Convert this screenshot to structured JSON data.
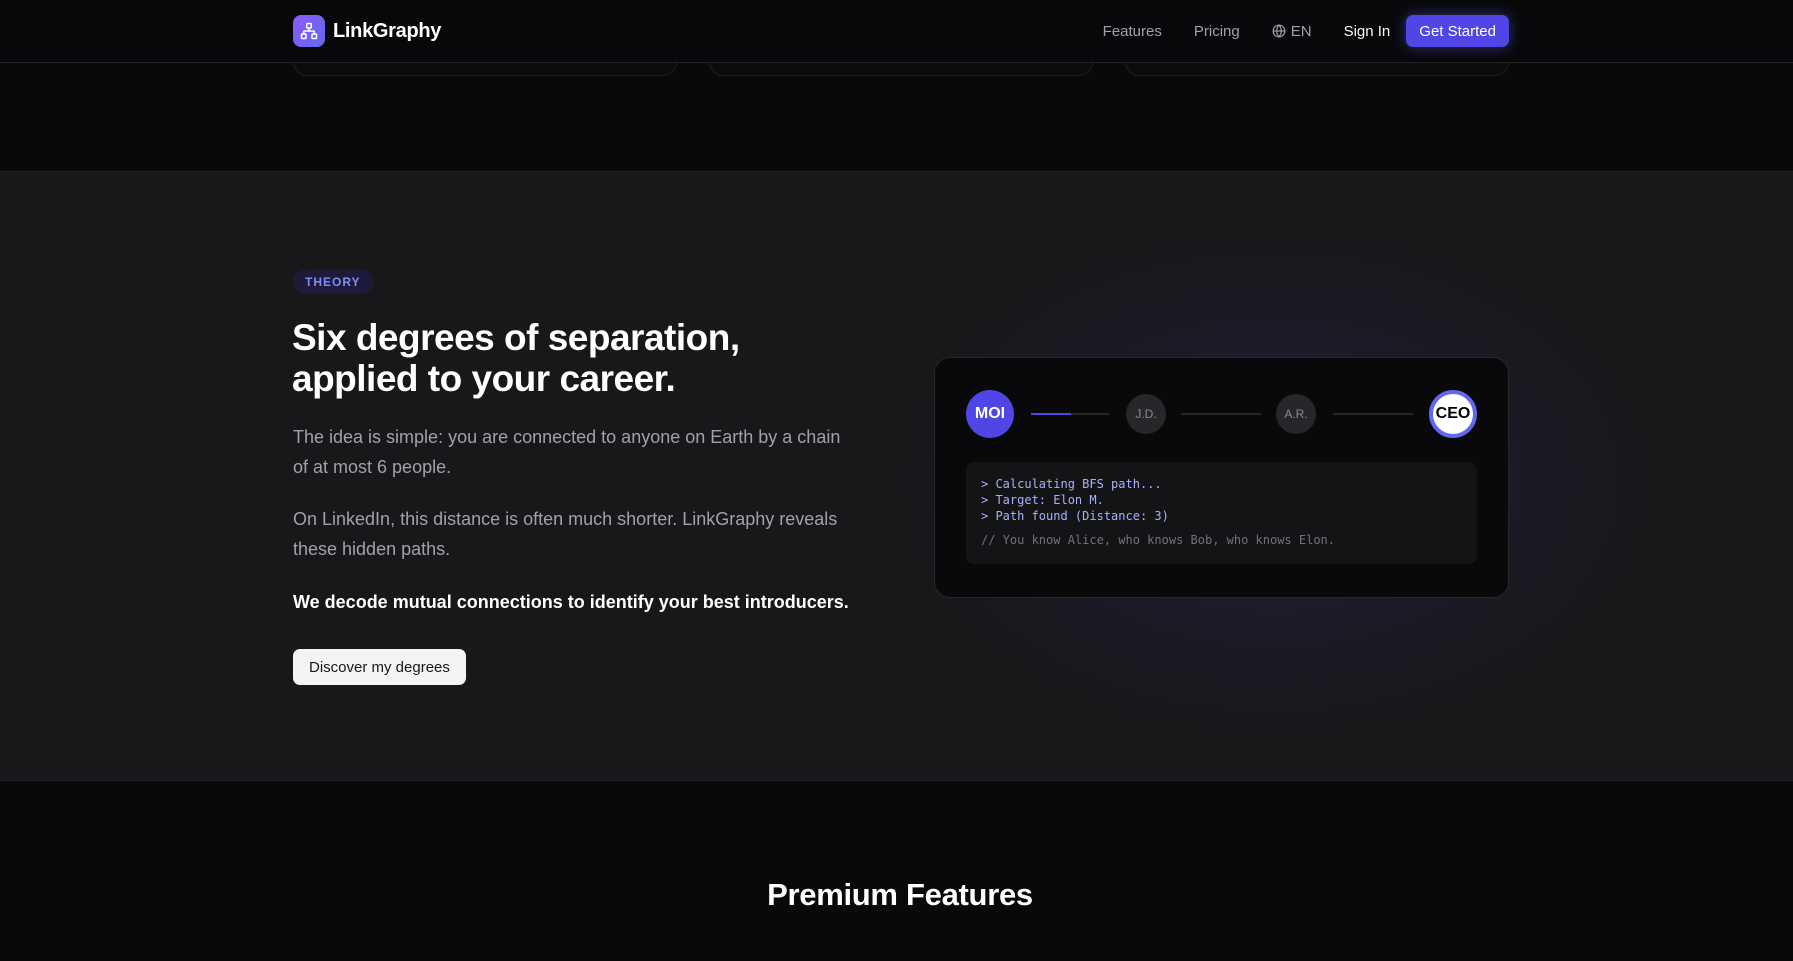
{
  "nav": {
    "brand": "LinkGraphy",
    "links": [
      "Features",
      "Pricing"
    ],
    "language": "EN",
    "sign_in": "Sign In",
    "get_started": "Get Started"
  },
  "theory": {
    "badge": "THEORY",
    "headline": "Six degrees of separation, applied to your career.",
    "paragraph1": "The idea is simple: you are connected to anyone on Earth by a chain of at most 6 people.",
    "paragraph2": "On LinkedIn, this distance is often much shorter. LinkGraphy reveals these hidden paths.",
    "emphasis": "We decode mutual connections to identify your best introducers.",
    "cta": "Discover my degrees"
  },
  "path_visual": {
    "nodes": [
      "MOI",
      "J.D.",
      "A.R.",
      "CEO"
    ],
    "terminal_lines": [
      "> Calculating BFS path...",
      "> Target: Elon M.",
      "> Path found (Distance: 3)"
    ],
    "terminal_comment": "// You know Alice, who knows Bob, who knows Elon."
  },
  "features": {
    "title": "Premium Features"
  },
  "colors": {
    "accent": "#4f46e5",
    "accent_light": "#818cf8",
    "background": "#09090b",
    "section_background": "#18181b"
  }
}
